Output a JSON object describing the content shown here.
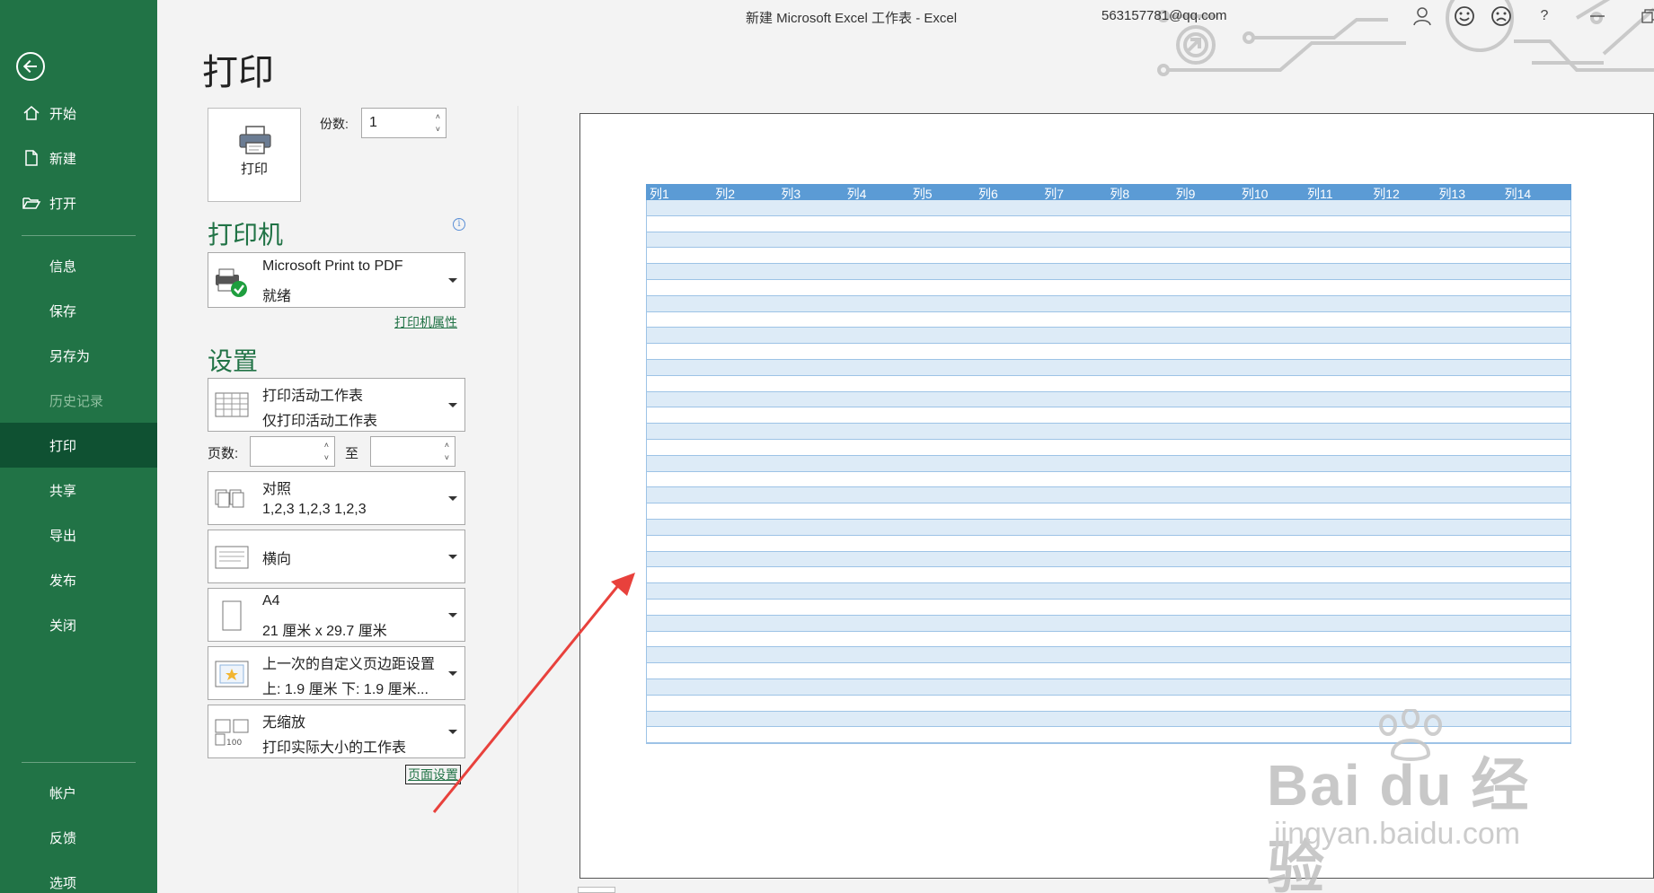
{
  "window": {
    "title": "新建 Microsoft Excel 工作表  -  Excel",
    "user_email": "563157781@qq.com",
    "help_label": "?"
  },
  "sidebar": {
    "items": [
      {
        "label": "开始",
        "icon": "home-icon"
      },
      {
        "label": "新建",
        "icon": "new-document-icon"
      },
      {
        "label": "打开",
        "icon": "open-folder-icon"
      },
      {
        "label": "信息"
      },
      {
        "label": "保存"
      },
      {
        "label": "另存为"
      },
      {
        "label": "历史记录",
        "disabled": true
      },
      {
        "label": "打印",
        "active": true
      },
      {
        "label": "共享"
      },
      {
        "label": "导出"
      },
      {
        "label": "发布"
      },
      {
        "label": "关闭"
      },
      {
        "label": "帐户"
      },
      {
        "label": "反馈"
      },
      {
        "label": "选项"
      }
    ]
  },
  "print": {
    "heading": "打印",
    "print_button": "打印",
    "copies_label": "份数:",
    "copies_value": "1",
    "printer_heading": "打印机",
    "printer_name": "Microsoft Print to PDF",
    "printer_status": "就绪",
    "printer_properties_link": "打印机属性",
    "settings_heading": "设置",
    "what_to_print": {
      "line1": "打印活动工作表",
      "line2": "仅打印活动工作表"
    },
    "pages_label": "页数:",
    "pages_to_label": "至",
    "collate": {
      "line1": "对照",
      "line2": "1,2,3    1,2,3    1,2,3"
    },
    "orientation": {
      "line1": "横向"
    },
    "paper_size": {
      "line1": "A4",
      "line2": "21 厘米 x 29.7 厘米"
    },
    "margins": {
      "line1": "上一次的自定义页边距设置",
      "line2": "上: 1.9 厘米 下: 1.9 厘米..."
    },
    "scaling": {
      "line1": "无缩放",
      "line2": "打印实际大小的工作表",
      "icon_text": "100"
    },
    "page_setup_link": "页面设置"
  },
  "preview": {
    "columns": [
      "列1",
      "列2",
      "列3",
      "列4",
      "列5",
      "列6",
      "列7",
      "列8",
      "列9",
      "列10",
      "列11",
      "列12",
      "列13",
      "列14"
    ],
    "row_count": 34,
    "header_color": "#5b9bd5",
    "band_color": "#ddebf7"
  },
  "annotation": {
    "arrow_color": "#e8413c"
  },
  "watermark": {
    "brand": "Bai du 经验",
    "url": "jingyan.baidu.com"
  }
}
